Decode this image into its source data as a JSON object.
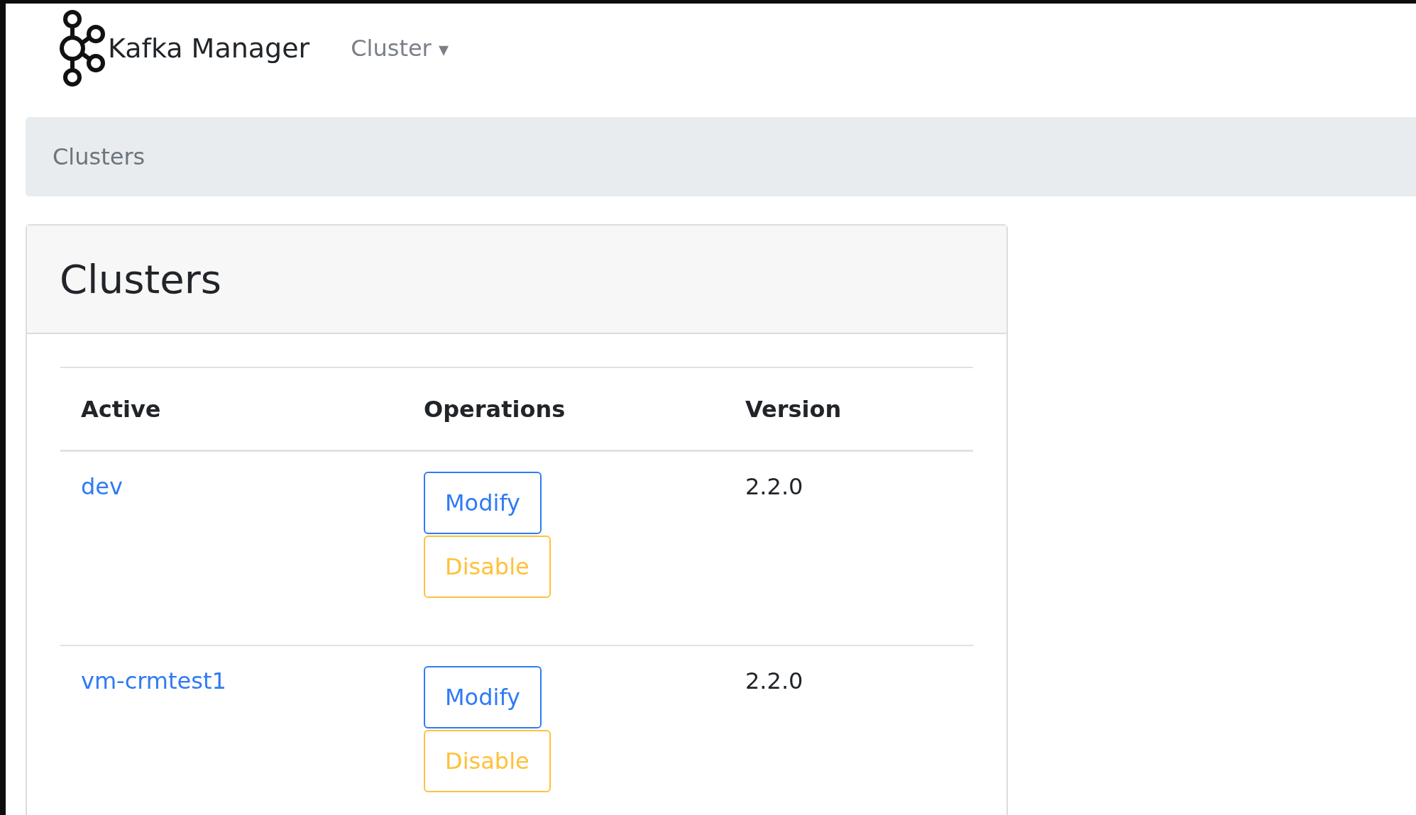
{
  "navbar": {
    "brand": "Kafka Manager",
    "menu": "Cluster",
    "menu_caret": "▾"
  },
  "breadcrumb": [
    "Clusters"
  ],
  "card": {
    "title": "Clusters",
    "table": {
      "columns": [
        "Active",
        "Operations",
        "Version"
      ],
      "rows": [
        {
          "name": "dev",
          "buttons": [
            {
              "label": "Modify",
              "kind": "primary"
            },
            {
              "label": "Disable",
              "kind": "warning"
            }
          ],
          "version": "2.2.0"
        },
        {
          "name": "vm-crmtest1",
          "buttons": [
            {
              "label": "Modify",
              "kind": "primary"
            },
            {
              "label": "Disable",
              "kind": "warning"
            }
          ],
          "version": "2.2.0"
        }
      ]
    }
  }
}
